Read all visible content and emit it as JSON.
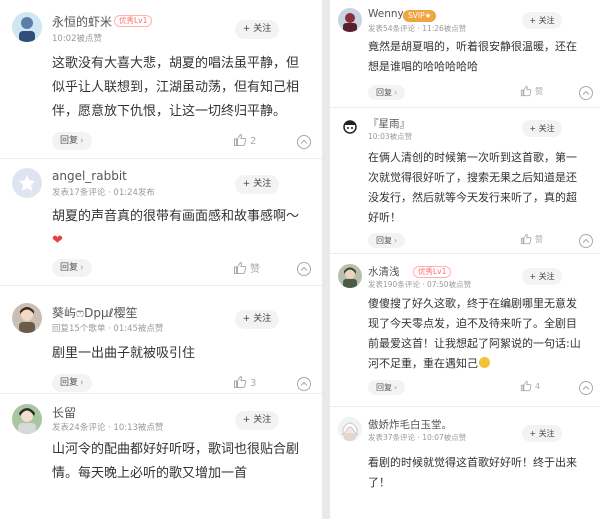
{
  "theme": {
    "accent": "#ff6a66",
    "svip": "#f0a640",
    "heart": "#e84040"
  },
  "left_comments": [
    {
      "username": "永恒的虾米",
      "badge": "优秀Lv1",
      "meta": "10:02被点赞",
      "follow": "+ 关注",
      "lines": [
        "这歌没有大喜大悲，胡夏的唱法虽平静，但",
        "似乎让人联想到，江湖虽动荡，但有知己相",
        "伴，愿意放下仇恨，让这一切终归平静。"
      ],
      "reply": "回复",
      "likes": "2"
    },
    {
      "username": "angel_rabbit",
      "meta": "发表17条评论 · 01:24发布",
      "follow": "+ 关注",
      "lines": [
        "胡夏的声音真的很带有画面感和故事感啊～"
      ],
      "heart_line": "❤",
      "reply": "回复",
      "likes": "赞"
    },
    {
      "username": "葵屿ෆDpµℓ樱笙",
      "meta": "回复15个歌单 · 01:45被点赞",
      "follow": "+ 关注",
      "lines": [
        "剧里一出曲子就被吸引住"
      ],
      "reply": "回复",
      "likes": "3"
    },
    {
      "username": "长留",
      "meta": "发表24条评论 · 10:13被点赞",
      "follow": "+ 关注",
      "lines": [
        "山河令的配曲都好好听呀，歌词也很贴合剧",
        "情。每天晚上必听的歌又增加一首"
      ],
      "reply": "",
      "likes": ""
    }
  ],
  "right_comments": [
    {
      "username": "Wenny",
      "badge": "SVIP★",
      "meta": "发表54条评论 · 11:26被点赞",
      "follow": "+ 关注",
      "lines": [
        "竟然是胡夏唱的，听着很安静很温暖，还在",
        "想是谁唱的哈哈哈哈哈"
      ],
      "reply": "回复",
      "likes": "赞"
    },
    {
      "username": "『星雨』",
      "meta": "10:03被点赞",
      "follow": "+ 关注",
      "lines": [
        "在俩人清创的时候第一次听到这首歌，第一",
        "次就觉得很好听了，搜索无果之后知道是还",
        "没发行，然后就等今天发行来听了，真的超",
        "好听！"
      ],
      "reply": "回复",
      "likes": "赞"
    },
    {
      "username": "水清浅",
      "badge": "优秀Lv1",
      "meta": "发表190条评论 · 07:50被点赞",
      "follow": "+ 关注",
      "lines": [
        "傻傻搜了好久这歌，终于在编剧哪里无意发",
        "现了今天零点发，迫不及待来听了。全剧目",
        "前最爱这首！让我想起了阿絮说的一句话:山",
        "河不足重，重在遇知己"
      ],
      "reply": "回复",
      "likes": "4"
    },
    {
      "username": "傲娇炸毛白玉堂。",
      "meta": "发表37条评论 · 10:07被点赞",
      "follow": "+ 关注",
      "lines": [
        "看剧的时候就觉得这首歌好好听！终于出来",
        "了！"
      ],
      "reply": "",
      "likes": ""
    }
  ]
}
